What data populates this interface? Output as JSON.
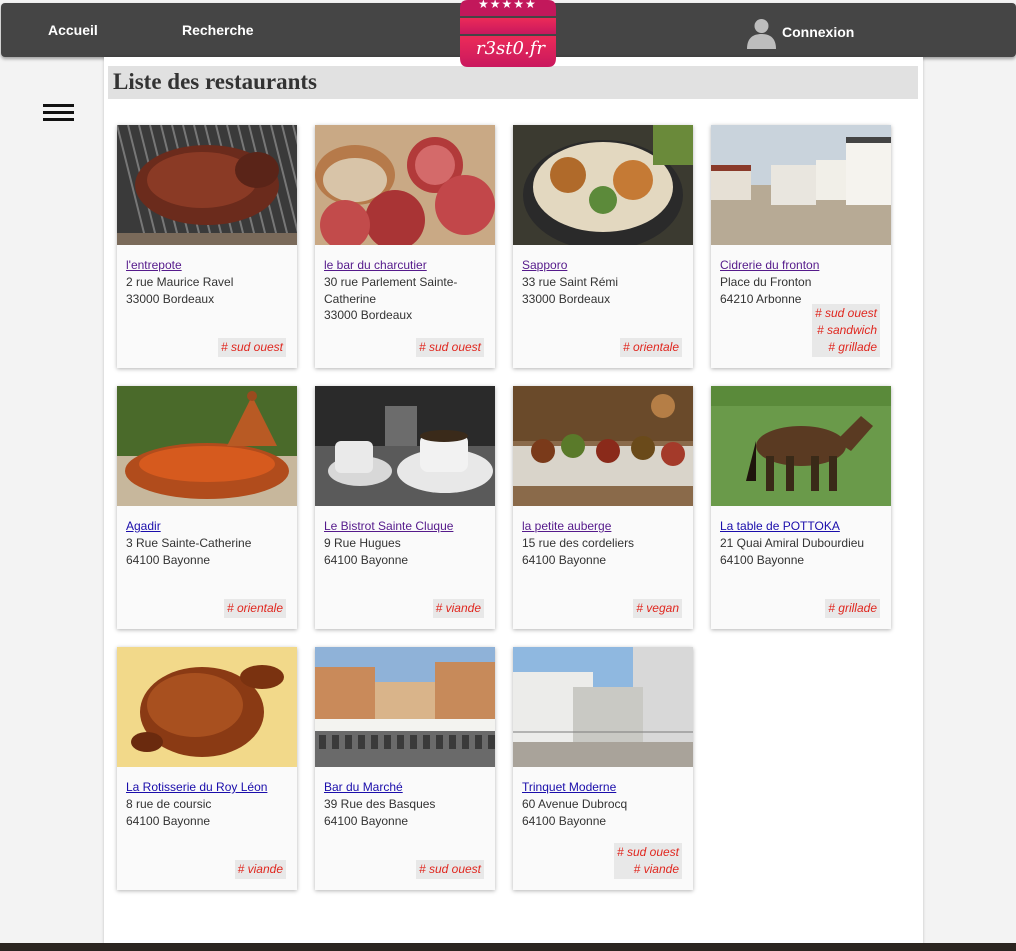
{
  "nav": {
    "home": "Accueil",
    "search": "Recherche",
    "login": "Connexion"
  },
  "logo": {
    "text": "r3st0.fr",
    "stars": "★★★★★"
  },
  "page": {
    "title": "Liste des restaurants"
  },
  "restaurants": [
    {
      "name": "l'entrepote",
      "street": "2 rue Maurice Ravel",
      "city": "33000 Bordeaux",
      "tags": [
        "# sud ouest"
      ],
      "image": "grilled-steak"
    },
    {
      "name": "le bar du charcutier",
      "street": "30 rue Parlement Sainte-Catherine",
      "city": "33000 Bordeaux",
      "tags": [
        "# sud ouest"
      ],
      "image": "charcuterie"
    },
    {
      "name": "Sapporo",
      "street": "33 rue Saint Rémi",
      "city": "33000 Bordeaux",
      "tags": [
        "# orientale"
      ],
      "image": "ramen-bowl"
    },
    {
      "name": "Cidrerie du fronton",
      "street": "Place du Fronton",
      "city": "64210 Arbonne",
      "tags": [
        "# sud ouest",
        "# sandwich",
        "# grillade"
      ],
      "image": "basque-fronton"
    },
    {
      "name": "Agadir",
      "street": "3 Rue Sainte-Catherine",
      "city": "64100 Bayonne",
      "tags": [
        "# orientale"
      ],
      "image": "tajine"
    },
    {
      "name": "Le Bistrot Sainte Cluque",
      "street": "9 Rue Hugues",
      "city": "64100 Bayonne",
      "tags": [
        "# viande"
      ],
      "image": "coffee-cups"
    },
    {
      "name": "la petite auberge",
      "street": "15 rue des cordeliers",
      "city": "64100 Bayonne",
      "tags": [
        "# vegan"
      ],
      "image": "tapas"
    },
    {
      "name": "La table de POTTOKA",
      "street": "21 Quai Amiral Dubourdieu",
      "city": "64100 Bayonne",
      "tags": [
        "# grillade"
      ],
      "image": "pottok-pony"
    },
    {
      "name": "La Rotisserie du Roy Léon",
      "street": "8 rue de coursic",
      "city": "64100 Bayonne",
      "tags": [
        "# viande"
      ],
      "image": "roast-chicken"
    },
    {
      "name": "Bar du Marché",
      "street": "39 Rue des Basques",
      "city": "64100 Bayonne",
      "tags": [
        "# sud ouest"
      ],
      "image": "market-square"
    },
    {
      "name": "Trinquet Moderne",
      "street": "60 Avenue Dubrocq",
      "city": "64100 Bayonne",
      "tags": [
        "# sud ouest",
        "# viande"
      ],
      "image": "pelota-court"
    }
  ],
  "colors": {
    "topbar": "#454545",
    "tag": "#e0271f",
    "link_visited": "#551a8b",
    "link": "#1a0dab",
    "logo_gradient": [
      "#e8234f",
      "#c2185b"
    ]
  }
}
